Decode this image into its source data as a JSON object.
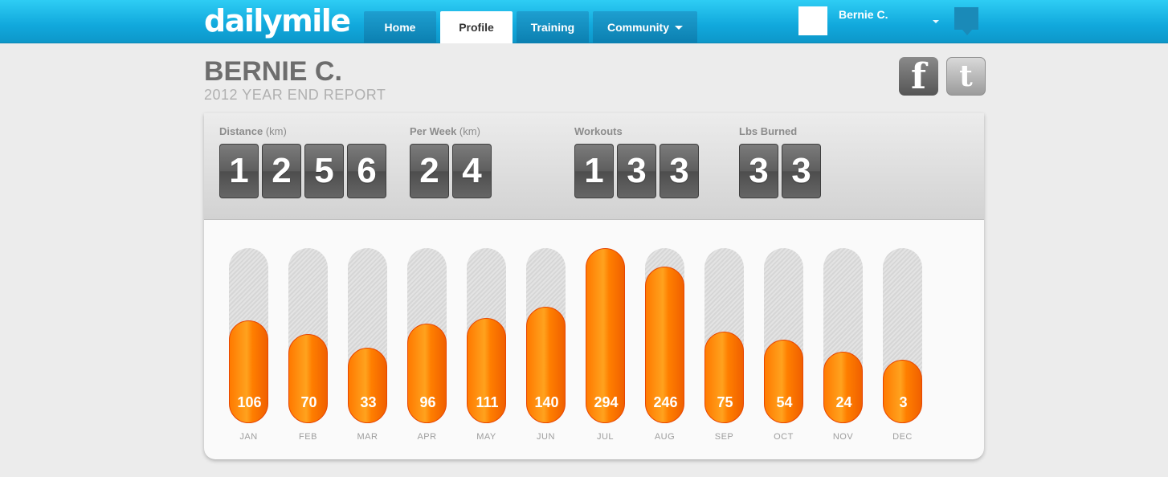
{
  "brand": {
    "logo_text": "dailymile",
    "accent": "#11a8dc",
    "bar_color": "#ff8a00"
  },
  "nav": {
    "tabs": [
      {
        "label": "Home"
      },
      {
        "label": "Profile",
        "active": true
      },
      {
        "label": "Training"
      },
      {
        "label": "Community",
        "has_dropdown": true
      }
    ],
    "user_name": "Bernie C.",
    "notification_icon": "speech-bubble-icon"
  },
  "header": {
    "title": "BERNIE C.",
    "subtitle": "2012 YEAR END REPORT",
    "share": [
      {
        "network": "facebook",
        "glyph": "f"
      },
      {
        "network": "twitter",
        "glyph": "t"
      }
    ]
  },
  "stats": [
    {
      "label": "Distance",
      "unit": "(km)",
      "digits": [
        "1",
        "2",
        "5",
        "6"
      ]
    },
    {
      "label": "Per Week",
      "unit": "(km)",
      "digits": [
        "2",
        "4"
      ]
    },
    {
      "label": "Workouts",
      "unit": "",
      "digits": [
        "1",
        "3",
        "3"
      ]
    },
    {
      "label": "Lbs Burned",
      "unit": "",
      "digits": [
        "3",
        "3"
      ]
    }
  ],
  "chart_data": {
    "type": "bar",
    "categories": [
      "JAN",
      "FEB",
      "MAR",
      "APR",
      "MAY",
      "JUN",
      "JUL",
      "AUG",
      "SEP",
      "OCT",
      "NOV",
      "DEC"
    ],
    "values": [
      106,
      70,
      33,
      96,
      111,
      140,
      294,
      246,
      75,
      54,
      24,
      3
    ],
    "ylim": [
      0,
      294
    ]
  }
}
